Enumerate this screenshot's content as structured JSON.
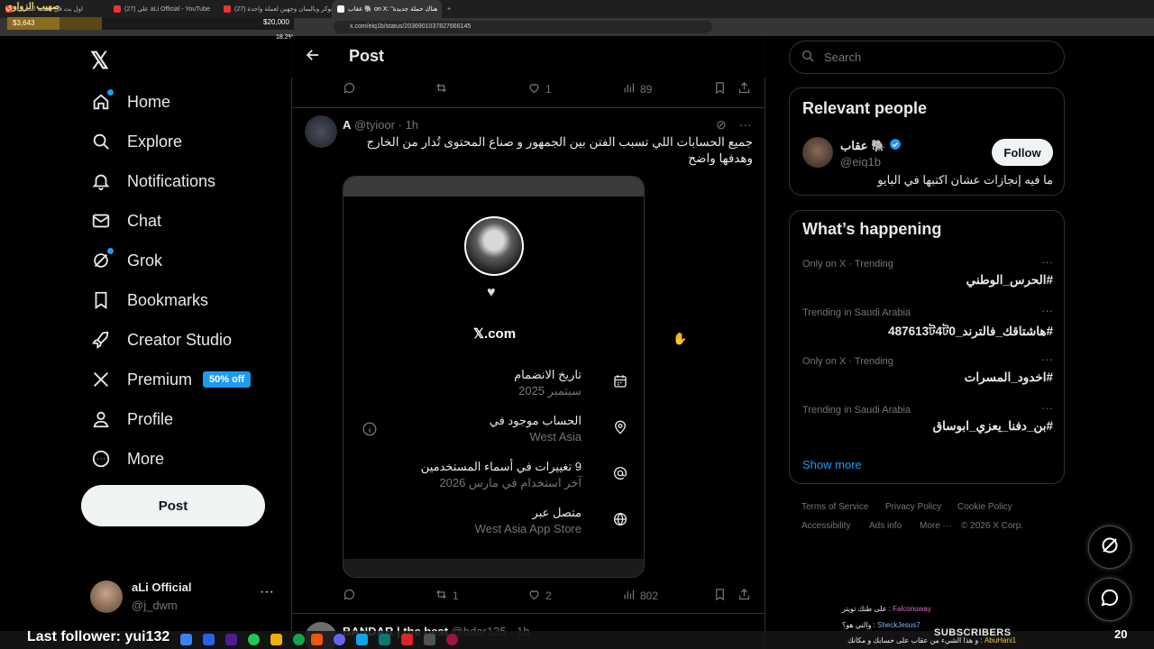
{
  "browser": {
    "tabs": [
      {
        "label": "اول بث في السنة الجديدة"
      },
      {
        "label": "(27) علي aLi Official - YouTube"
      },
      {
        "label": "(27) الحوكر وباليمان وجهين لعملة واحدة"
      },
      {
        "label": "عقاب 🐘 on X: \"هناك حملة جديدة"
      }
    ],
    "url": "x.com/eiq1b/status/2036901037827666145"
  },
  "stream": {
    "channel_name": "صهيب الزواوي",
    "bar_amount": "$3,643",
    "bar_goal": "$20,000",
    "bar_percent": "18.2%",
    "bar_fill": 0.182,
    "last_follower": "Last follower: yui132",
    "subscribers_label": "SUBSCRIBERS",
    "subscribers_count": "20",
    "chat": [
      {
        "user": "Falconuway",
        "msg": "على طنك تويتر",
        "color": "#e06bd6"
      },
      {
        "user": "SheckJesus7",
        "msg": "والتي هو؟",
        "color": "#7fb7ff"
      },
      {
        "user": "AbuHani1",
        "msg": "و هذا الشيء من عقاب على حسابك و مكانك",
        "color": "#f3c04a"
      }
    ]
  },
  "nav": {
    "items": [
      {
        "label": "Home",
        "icon": "home-icon",
        "dot": true
      },
      {
        "label": "Explore",
        "icon": "search-icon",
        "dot": false
      },
      {
        "label": "Notifications",
        "icon": "bell-icon",
        "dot": false
      },
      {
        "label": "Chat",
        "icon": "mail-icon",
        "dot": false
      },
      {
        "label": "Grok",
        "icon": "grok-icon",
        "dot": true
      },
      {
        "label": "Bookmarks",
        "icon": "bookmark-icon",
        "dot": false
      },
      {
        "label": "Creator Studio",
        "icon": "rocket-icon",
        "dot": false
      },
      {
        "label": "Premium",
        "icon": "x-logo-icon",
        "dot": false
      },
      {
        "label": "Profile",
        "icon": "person-icon",
        "dot": false
      },
      {
        "label": "More",
        "icon": "more-circle-icon",
        "dot": false
      }
    ],
    "premium_tag": "50% off",
    "post_button": "Post",
    "account": {
      "name": "aLi Official",
      "handle": "@j_dwm"
    }
  },
  "main": {
    "title": "Post",
    "top_actions": {
      "replies": "",
      "reposts": "",
      "likes": "1",
      "views": "89"
    },
    "tweet": {
      "author": "A",
      "handle": "@tyioor",
      "time": "· 1h",
      "text": "جميع الحسابات اللي تسبب الفتن بين الجمهور و صناع المحتوى تُدار من الخارج وهدفها واضح",
      "card": {
        "domain": "𝕏.com",
        "rows": [
          {
            "title": "تاريخ الانضمام",
            "sub": "سبتمبر 2025",
            "icon": "calendar-icon"
          },
          {
            "title": "الحساب موجود في",
            "sub": "West Asia",
            "icon": "location-pin-icon"
          },
          {
            "title": "9 تغييرات في أسماء المستخدمين",
            "sub": "آخر استخدام في مارس 2026",
            "icon": "at-sign-icon"
          },
          {
            "title": "متصل عبر",
            "sub": "West Asia App Store",
            "icon": "globe-icon"
          }
        ]
      },
      "actions": {
        "replies": "",
        "reposts": "1",
        "likes": "2",
        "views": "802"
      }
    },
    "next_tweet": {
      "author": "BANDAR | the best",
      "handle": "@bdar135",
      "time": "· 1h"
    }
  },
  "right": {
    "search_placeholder": "Search",
    "relevant_people": {
      "title": "Relevant people",
      "name": "عقاب 🐘",
      "handle": "@eiq1b",
      "follow": "Follow",
      "bio": "ما فيه إنجازات عشان اكتبها في البايو"
    },
    "whats_happening": {
      "title": "What’s happening",
      "trends": [
        {
          "meta": "Only on X · Trending",
          "name": "#الحرس_الوطني"
        },
        {
          "meta": "Trending in Saudi Arabia",
          "name": "#هاشتاقك_فالترند_487613ট4ট0"
        },
        {
          "meta": "Only on X · Trending",
          "name": "#اخدود_المسرات"
        },
        {
          "meta": "Trending in Saudi Arabia",
          "name": "#بن_دفنا_يعزي_ابوساق"
        }
      ],
      "show_more": "Show more"
    },
    "footer": {
      "terms": "Terms of Service",
      "privacy": "Privacy Policy",
      "cookie": "Cookie Policy",
      "accessibility": "Accessibility",
      "ads": "Ads info",
      "more": "More ···",
      "copyright": "© 2026 X Corp."
    }
  },
  "colors": {
    "accent": "#1d9bf0",
    "background": "#000000",
    "text": "#e7e9ea",
    "muted": "#71767b",
    "border": "#2f3336"
  }
}
